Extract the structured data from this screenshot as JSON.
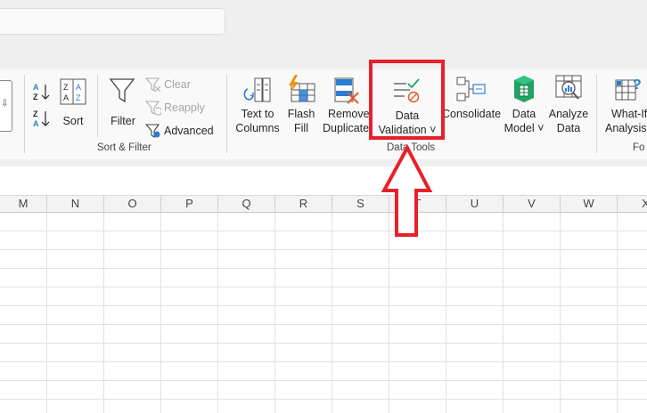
{
  "ribbon": {
    "sort_filter": {
      "sort_label": "Sort",
      "filter_label": "Filter",
      "clear_label": "Clear",
      "reapply_label": "Reapply",
      "advanced_label": "Advanced",
      "group_label": "Sort & Filter"
    },
    "data_tools": {
      "text_to_columns": [
        "Text to",
        "Columns"
      ],
      "flash_fill": [
        "Flash",
        "Fill"
      ],
      "remove_duplicates": [
        "Remove",
        "Duplicates"
      ],
      "data_validation": [
        "Data",
        "Validation ˅"
      ],
      "consolidate": "Consolidate",
      "data_model": [
        "Data",
        "Model ˅"
      ],
      "analyze_data": [
        "Analyze",
        "Data"
      ],
      "group_label": "Data Tools"
    },
    "forecast": {
      "what_if": [
        "What-If",
        "Analysis ˅"
      ],
      "group_label": "Fo"
    }
  },
  "columns": [
    "M",
    "N",
    "O",
    "P",
    "Q",
    "R",
    "S",
    "T",
    "U",
    "V",
    "W",
    "X"
  ],
  "colors": {
    "highlight": "#e8202a",
    "accent_green": "#21a366",
    "icon_blue": "#2b7cd3"
  }
}
